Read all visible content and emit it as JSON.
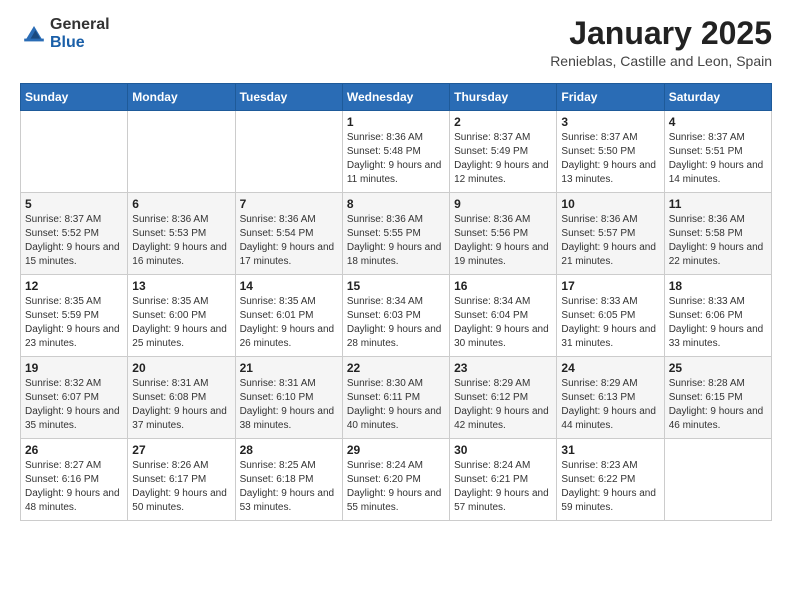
{
  "logo": {
    "general": "General",
    "blue": "Blue"
  },
  "title": "January 2025",
  "location": "Renieblas, Castille and Leon, Spain",
  "days_of_week": [
    "Sunday",
    "Monday",
    "Tuesday",
    "Wednesday",
    "Thursday",
    "Friday",
    "Saturday"
  ],
  "weeks": [
    [
      {
        "day": "",
        "sunrise": "",
        "sunset": "",
        "daylight": ""
      },
      {
        "day": "",
        "sunrise": "",
        "sunset": "",
        "daylight": ""
      },
      {
        "day": "",
        "sunrise": "",
        "sunset": "",
        "daylight": ""
      },
      {
        "day": "1",
        "sunrise": "Sunrise: 8:36 AM",
        "sunset": "Sunset: 5:48 PM",
        "daylight": "Daylight: 9 hours and 11 minutes."
      },
      {
        "day": "2",
        "sunrise": "Sunrise: 8:37 AM",
        "sunset": "Sunset: 5:49 PM",
        "daylight": "Daylight: 9 hours and 12 minutes."
      },
      {
        "day": "3",
        "sunrise": "Sunrise: 8:37 AM",
        "sunset": "Sunset: 5:50 PM",
        "daylight": "Daylight: 9 hours and 13 minutes."
      },
      {
        "day": "4",
        "sunrise": "Sunrise: 8:37 AM",
        "sunset": "Sunset: 5:51 PM",
        "daylight": "Daylight: 9 hours and 14 minutes."
      }
    ],
    [
      {
        "day": "5",
        "sunrise": "Sunrise: 8:37 AM",
        "sunset": "Sunset: 5:52 PM",
        "daylight": "Daylight: 9 hours and 15 minutes."
      },
      {
        "day": "6",
        "sunrise": "Sunrise: 8:36 AM",
        "sunset": "Sunset: 5:53 PM",
        "daylight": "Daylight: 9 hours and 16 minutes."
      },
      {
        "day": "7",
        "sunrise": "Sunrise: 8:36 AM",
        "sunset": "Sunset: 5:54 PM",
        "daylight": "Daylight: 9 hours and 17 minutes."
      },
      {
        "day": "8",
        "sunrise": "Sunrise: 8:36 AM",
        "sunset": "Sunset: 5:55 PM",
        "daylight": "Daylight: 9 hours and 18 minutes."
      },
      {
        "day": "9",
        "sunrise": "Sunrise: 8:36 AM",
        "sunset": "Sunset: 5:56 PM",
        "daylight": "Daylight: 9 hours and 19 minutes."
      },
      {
        "day": "10",
        "sunrise": "Sunrise: 8:36 AM",
        "sunset": "Sunset: 5:57 PM",
        "daylight": "Daylight: 9 hours and 21 minutes."
      },
      {
        "day": "11",
        "sunrise": "Sunrise: 8:36 AM",
        "sunset": "Sunset: 5:58 PM",
        "daylight": "Daylight: 9 hours and 22 minutes."
      }
    ],
    [
      {
        "day": "12",
        "sunrise": "Sunrise: 8:35 AM",
        "sunset": "Sunset: 5:59 PM",
        "daylight": "Daylight: 9 hours and 23 minutes."
      },
      {
        "day": "13",
        "sunrise": "Sunrise: 8:35 AM",
        "sunset": "Sunset: 6:00 PM",
        "daylight": "Daylight: 9 hours and 25 minutes."
      },
      {
        "day": "14",
        "sunrise": "Sunrise: 8:35 AM",
        "sunset": "Sunset: 6:01 PM",
        "daylight": "Daylight: 9 hours and 26 minutes."
      },
      {
        "day": "15",
        "sunrise": "Sunrise: 8:34 AM",
        "sunset": "Sunset: 6:03 PM",
        "daylight": "Daylight: 9 hours and 28 minutes."
      },
      {
        "day": "16",
        "sunrise": "Sunrise: 8:34 AM",
        "sunset": "Sunset: 6:04 PM",
        "daylight": "Daylight: 9 hours and 30 minutes."
      },
      {
        "day": "17",
        "sunrise": "Sunrise: 8:33 AM",
        "sunset": "Sunset: 6:05 PM",
        "daylight": "Daylight: 9 hours and 31 minutes."
      },
      {
        "day": "18",
        "sunrise": "Sunrise: 8:33 AM",
        "sunset": "Sunset: 6:06 PM",
        "daylight": "Daylight: 9 hours and 33 minutes."
      }
    ],
    [
      {
        "day": "19",
        "sunrise": "Sunrise: 8:32 AM",
        "sunset": "Sunset: 6:07 PM",
        "daylight": "Daylight: 9 hours and 35 minutes."
      },
      {
        "day": "20",
        "sunrise": "Sunrise: 8:31 AM",
        "sunset": "Sunset: 6:08 PM",
        "daylight": "Daylight: 9 hours and 37 minutes."
      },
      {
        "day": "21",
        "sunrise": "Sunrise: 8:31 AM",
        "sunset": "Sunset: 6:10 PM",
        "daylight": "Daylight: 9 hours and 38 minutes."
      },
      {
        "day": "22",
        "sunrise": "Sunrise: 8:30 AM",
        "sunset": "Sunset: 6:11 PM",
        "daylight": "Daylight: 9 hours and 40 minutes."
      },
      {
        "day": "23",
        "sunrise": "Sunrise: 8:29 AM",
        "sunset": "Sunset: 6:12 PM",
        "daylight": "Daylight: 9 hours and 42 minutes."
      },
      {
        "day": "24",
        "sunrise": "Sunrise: 8:29 AM",
        "sunset": "Sunset: 6:13 PM",
        "daylight": "Daylight: 9 hours and 44 minutes."
      },
      {
        "day": "25",
        "sunrise": "Sunrise: 8:28 AM",
        "sunset": "Sunset: 6:15 PM",
        "daylight": "Daylight: 9 hours and 46 minutes."
      }
    ],
    [
      {
        "day": "26",
        "sunrise": "Sunrise: 8:27 AM",
        "sunset": "Sunset: 6:16 PM",
        "daylight": "Daylight: 9 hours and 48 minutes."
      },
      {
        "day": "27",
        "sunrise": "Sunrise: 8:26 AM",
        "sunset": "Sunset: 6:17 PM",
        "daylight": "Daylight: 9 hours and 50 minutes."
      },
      {
        "day": "28",
        "sunrise": "Sunrise: 8:25 AM",
        "sunset": "Sunset: 6:18 PM",
        "daylight": "Daylight: 9 hours and 53 minutes."
      },
      {
        "day": "29",
        "sunrise": "Sunrise: 8:24 AM",
        "sunset": "Sunset: 6:20 PM",
        "daylight": "Daylight: 9 hours and 55 minutes."
      },
      {
        "day": "30",
        "sunrise": "Sunrise: 8:24 AM",
        "sunset": "Sunset: 6:21 PM",
        "daylight": "Daylight: 9 hours and 57 minutes."
      },
      {
        "day": "31",
        "sunrise": "Sunrise: 8:23 AM",
        "sunset": "Sunset: 6:22 PM",
        "daylight": "Daylight: 9 hours and 59 minutes."
      },
      {
        "day": "",
        "sunrise": "",
        "sunset": "",
        "daylight": ""
      }
    ]
  ]
}
